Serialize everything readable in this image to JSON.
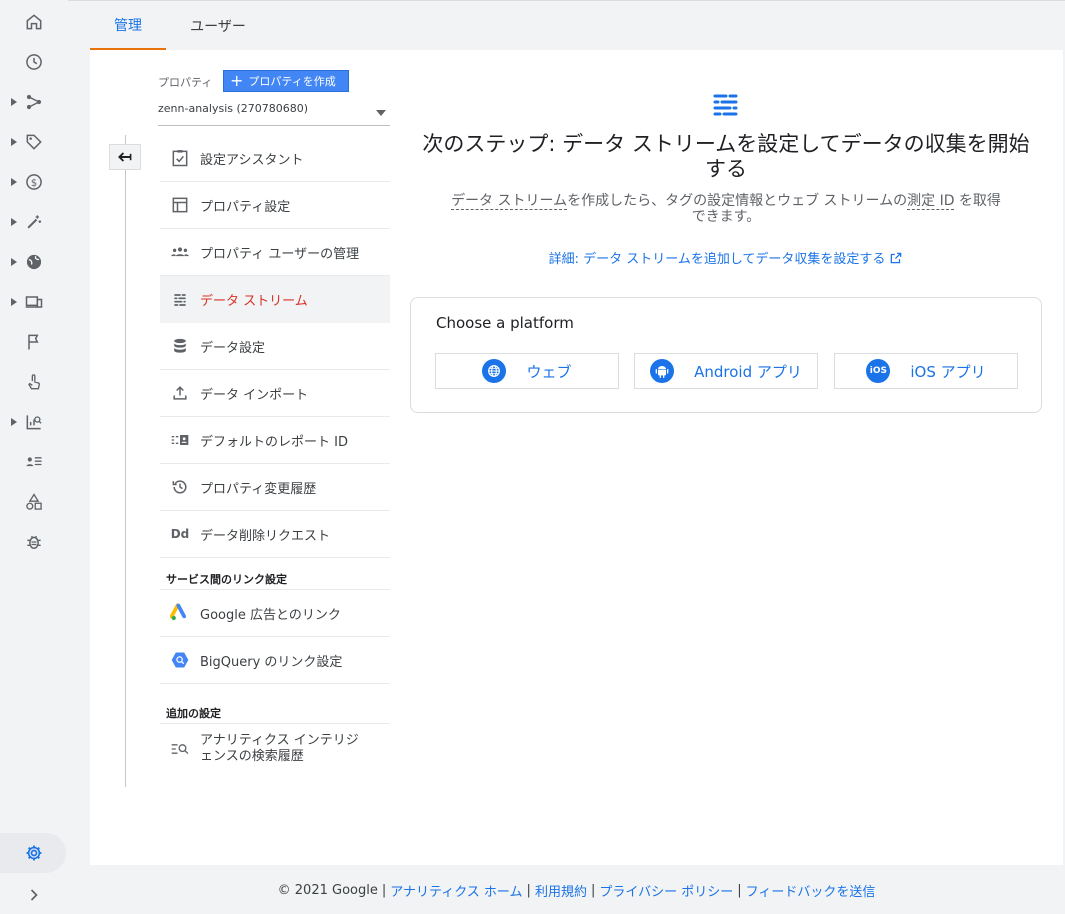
{
  "tabs": [
    {
      "label": "管理"
    },
    {
      "label": "ユーザー"
    }
  ],
  "rail": {
    "icons": [
      "home-icon",
      "clock-icon",
      "share-icon",
      "tag-icon",
      "dollar-icon",
      "magic-wand-icon",
      "globe-icon",
      "devices-icon",
      "flag-icon",
      "touch-icon",
      "analytics-search-icon",
      "user-list-icon",
      "shapes-icon",
      "bug-icon"
    ],
    "settings_icon": "gear-icon",
    "expand_icon": "chevron-right-icon"
  },
  "property": {
    "label": "プロパティ",
    "create_button": "プロパティを作成",
    "selected": "zenn-analysis (270780680)"
  },
  "nav": {
    "items": [
      {
        "label": "設定アシスタント",
        "icon": "checklist-icon"
      },
      {
        "label": "プロパティ設定",
        "icon": "layout-icon"
      },
      {
        "label": "プロパティ ユーザーの管理",
        "icon": "group-icon"
      },
      {
        "label": "データ ストリーム",
        "icon": "streams-icon"
      },
      {
        "label": "データ設定",
        "icon": "database-icon"
      },
      {
        "label": "データ インポート",
        "icon": "upload-icon"
      },
      {
        "label": "デフォルトのレポート ID",
        "icon": "report-id-icon"
      },
      {
        "label": "プロパティ変更履歴",
        "icon": "history-icon"
      },
      {
        "label": "データ削除リクエスト",
        "icon": "dd-icon"
      }
    ],
    "dd_text": "Dd",
    "links_header": "サービス間のリンク設定",
    "links": [
      {
        "label": "Google 広告とのリンク",
        "icon": "google-ads-icon"
      },
      {
        "label": "BigQuery のリンク設定",
        "icon": "bigquery-icon"
      }
    ],
    "extra_header": "追加の設定",
    "extra": [
      {
        "label_line1": "アナリティクス インテリジ",
        "label_line2": "ェンスの検索履歴",
        "icon": "search-history-icon"
      }
    ]
  },
  "main": {
    "heading_line1": "次のステップ: データ ストリームを設定してデータの収集を開始",
    "heading_line2": "する",
    "sub_part1": "データ ストリーム",
    "sub_part2": "を作成したら、タグの設定情報とウェブ ストリームの",
    "sub_part3": "測定 ID",
    "sub_part4": " を取得",
    "sub_line2": "できます。",
    "learn_more": "詳細: データ ストリームを追加してデータ収集を設定する",
    "platform_title": "Choose a platform",
    "platforms": [
      {
        "label": "ウェブ",
        "icon": "globe-icon"
      },
      {
        "label": "Android アプリ",
        "icon": "android-icon"
      },
      {
        "label": "iOS アプリ",
        "icon": "ios-icon",
        "badge": "iOS"
      }
    ]
  },
  "footer": {
    "copyright": "© 2021 Google",
    "links": [
      "アナリティクス ホーム",
      "利用規約",
      "プライバシー ポリシー",
      "フィードバックを送信"
    ],
    "separator": "|"
  },
  "colors": {
    "accent": "#1a73e8",
    "selected_text": "#d93025",
    "tab_indicator": "#e8710a",
    "create_button": "#4285f4"
  }
}
